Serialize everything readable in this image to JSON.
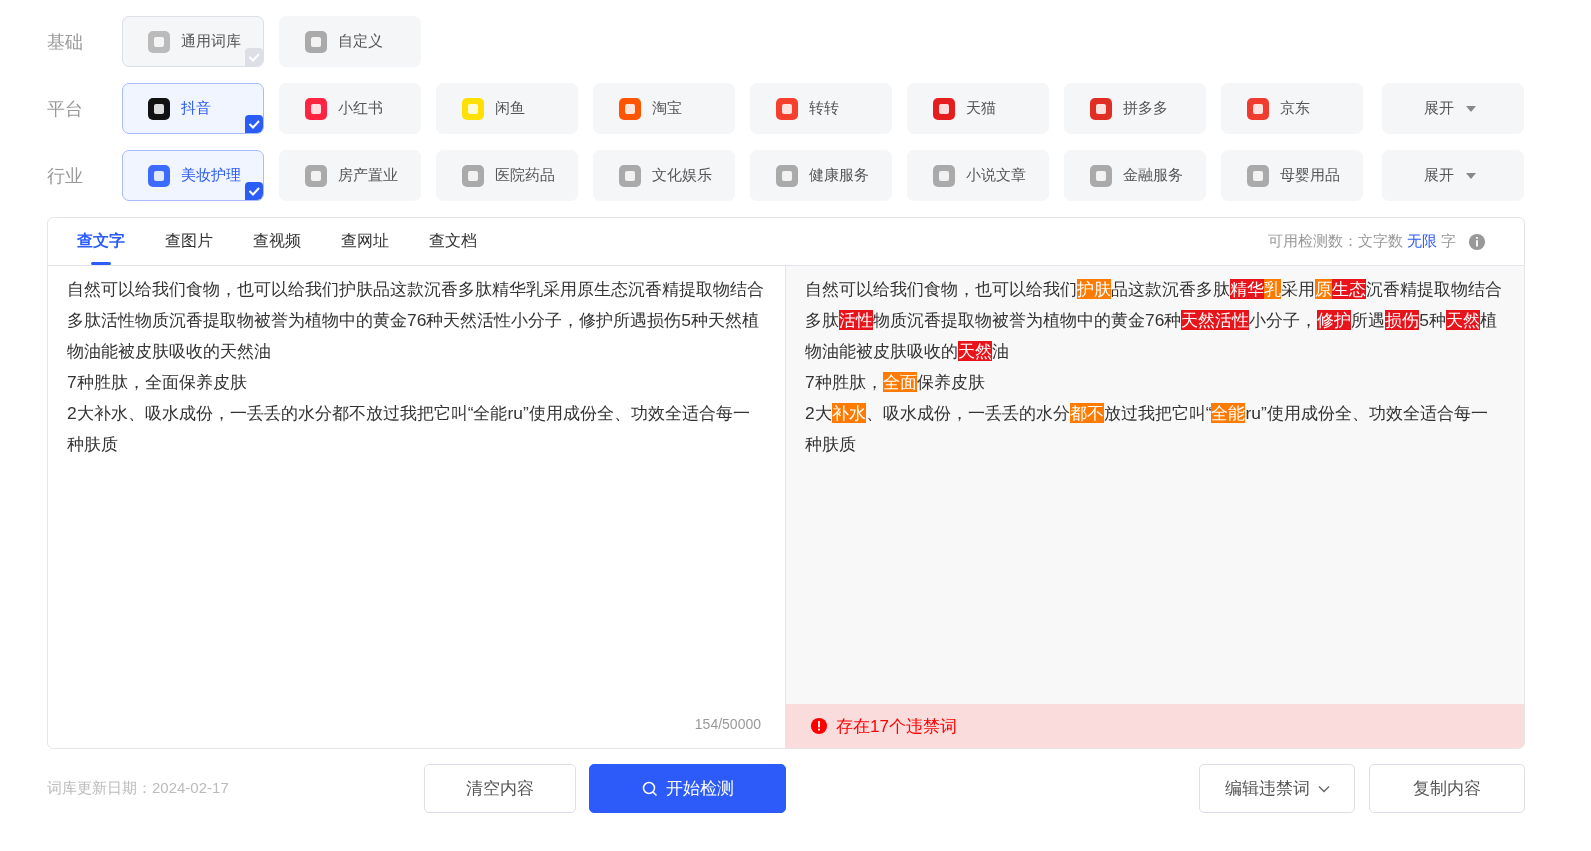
{
  "filters": [
    {
      "label": "基础",
      "items": [
        {
          "label": "通用词库",
          "selected": true,
          "locked": true
        },
        {
          "label": "自定义",
          "selected": false,
          "locked": false
        }
      ]
    },
    {
      "label": "平台",
      "items": [
        {
          "label": "抖音",
          "selected": true,
          "locked": false
        },
        {
          "label": "小红书",
          "selected": false,
          "locked": false
        },
        {
          "label": "闲鱼",
          "selected": false,
          "locked": false
        },
        {
          "label": "淘宝",
          "selected": false,
          "locked": false
        },
        {
          "label": "转转",
          "selected": false,
          "locked": false
        },
        {
          "label": "天猫",
          "selected": false,
          "locked": false
        },
        {
          "label": "拼多多",
          "selected": false,
          "locked": false
        },
        {
          "label": "京东",
          "selected": false,
          "locked": false
        }
      ],
      "expand": "展开"
    },
    {
      "label": "行业",
      "items": [
        {
          "label": "美妆护理",
          "selected": true,
          "locked": false
        },
        {
          "label": "房产置业",
          "selected": false,
          "locked": false
        },
        {
          "label": "医院药品",
          "selected": false,
          "locked": false
        },
        {
          "label": "文化娱乐",
          "selected": false,
          "locked": false
        },
        {
          "label": "健康服务",
          "selected": false,
          "locked": false
        },
        {
          "label": "小说文章",
          "selected": false,
          "locked": false
        },
        {
          "label": "金融服务",
          "selected": false,
          "locked": false
        },
        {
          "label": "母婴用品",
          "selected": false,
          "locked": false
        }
      ],
      "expand": "展开"
    }
  ],
  "tabs": [
    {
      "label": "查文字",
      "selected": true
    },
    {
      "label": "查图片",
      "selected": false
    },
    {
      "label": "查视频",
      "selected": false
    },
    {
      "label": "查网址",
      "selected": false
    },
    {
      "label": "查文档",
      "selected": false
    }
  ],
  "quota": {
    "label": "可用检测数：文字数",
    "value": "无限",
    "unit": "字"
  },
  "input": {
    "value": "自然可以给我们食物，也可以给我们护肤品这款沉香多肽精华乳采用原生态沉香精提取物结合多肽活性物质沉香提取物被誉为植物中的黄金76种天然活性小分子，修护所遇损伤5种天然植物油能被皮肤吸收的天然油\n7种胜肽，全面保养皮肤\n2大补水、吸水成份，一丢丢的水分都不放过我把它叫“全能ru”使用成份全、功效全适合每一种肤质",
    "count": "154/50000"
  },
  "result": {
    "paragraphs": [
      [
        {
          "text": "自然可以给我们食物，也可以给我们",
          "kind": "plain"
        },
        {
          "text": "护肤",
          "kind": "orange"
        },
        {
          "text": "品这款沉香多肽",
          "kind": "plain"
        },
        {
          "text": "精华",
          "kind": "red"
        },
        {
          "text": "乳",
          "kind": "orange"
        },
        {
          "text": "采用",
          "kind": "plain"
        },
        {
          "text": "原",
          "kind": "orange"
        },
        {
          "text": "生态",
          "kind": "red"
        },
        {
          "text": "沉香精提取物结合多肽",
          "kind": "plain"
        },
        {
          "text": "活性",
          "kind": "red"
        },
        {
          "text": "物质沉香提取物被誉为植物中的黄金76种",
          "kind": "plain"
        },
        {
          "text": "天然活性",
          "kind": "red"
        },
        {
          "text": "小分子，",
          "kind": "plain"
        },
        {
          "text": "修护",
          "kind": "red"
        },
        {
          "text": "所遇",
          "kind": "plain"
        },
        {
          "text": "损伤",
          "kind": "red"
        },
        {
          "text": "5种",
          "kind": "plain"
        },
        {
          "text": "天然",
          "kind": "red"
        },
        {
          "text": "植物油能被皮肤吸收的",
          "kind": "plain"
        },
        {
          "text": "天然",
          "kind": "red"
        },
        {
          "text": "油",
          "kind": "plain"
        }
      ],
      [
        {
          "text": "7种胜肽，",
          "kind": "plain"
        },
        {
          "text": "全面",
          "kind": "orange"
        },
        {
          "text": "保养皮肤",
          "kind": "plain"
        }
      ],
      [
        {
          "text": "2大",
          "kind": "plain"
        },
        {
          "text": "补水",
          "kind": "orange"
        },
        {
          "text": "、吸水成份，一丢丢的水分",
          "kind": "plain"
        },
        {
          "text": "都不",
          "kind": "orange"
        },
        {
          "text": "放过我把它叫“",
          "kind": "plain"
        },
        {
          "text": "全能",
          "kind": "orange"
        },
        {
          "text": "ru”使用成份全、功效全适合每一种肤质",
          "kind": "plain"
        }
      ]
    ],
    "alert": "存在17个违禁词"
  },
  "footer": {
    "updated": "词库更新日期：2024-02-17",
    "clear": "清空内容",
    "check": "开始检测",
    "edit": "编辑违禁词",
    "copy": "复制内容"
  }
}
